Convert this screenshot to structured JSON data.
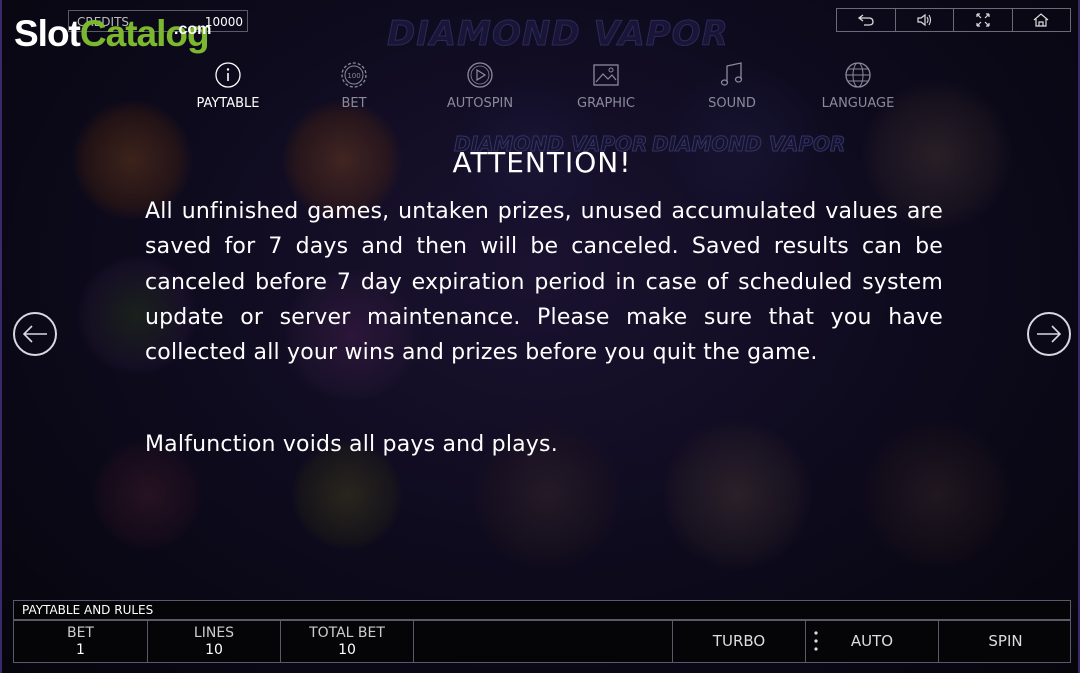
{
  "watermark": {
    "slot": "Slot",
    "catalog": "Catalog",
    "com": ".com"
  },
  "background_logo": {
    "title": "DIAMOND VAPOR"
  },
  "credits": {
    "label": "CREDITS",
    "value": "10000"
  },
  "top_controls": [
    {
      "icon": "back-arrow-icon"
    },
    {
      "icon": "speaker-icon"
    },
    {
      "icon": "fullscreen-icon"
    },
    {
      "icon": "home-icon"
    }
  ],
  "tabs": [
    {
      "label": "PAYTABLE",
      "icon": "info-icon",
      "active": true
    },
    {
      "label": "BET",
      "icon": "chip-icon",
      "chip_text": "100"
    },
    {
      "label": "AUTOSPIN",
      "icon": "play-circle-icon"
    },
    {
      "label": "GRAPHIC",
      "icon": "image-icon"
    },
    {
      "label": "SOUND",
      "icon": "music-note-icon"
    },
    {
      "label": "LANGUAGE",
      "icon": "globe-icon"
    }
  ],
  "content": {
    "heading": "ATTENTION!",
    "paragraph1": "All unfinished games, untaken prizes, unused accumulated values are saved for 7 days and then will be canceled. Saved results can be canceled before 7 day expiration period in case of scheduled system update or server maintenance. Please make sure that you have collected all your wins and prizes before you quit the game.",
    "paragraph2": "Malfunction voids all pays and plays."
  },
  "nav": {
    "left_icon": "arrow-left-icon",
    "right_icon": "arrow-right-icon"
  },
  "bottom": {
    "rules_label": "PAYTABLE AND RULES",
    "bet": {
      "label": "BET",
      "value": "1"
    },
    "lines": {
      "label": "LINES",
      "value": "10"
    },
    "total_bet": {
      "label": "TOTAL BET",
      "value": "10"
    },
    "turbo": "TURBO",
    "auto": "AUTO",
    "spin": "SPIN"
  },
  "colors": {
    "accent_green": "#7cb82f",
    "text": "#ffffff",
    "border": "#5a5a6a"
  }
}
